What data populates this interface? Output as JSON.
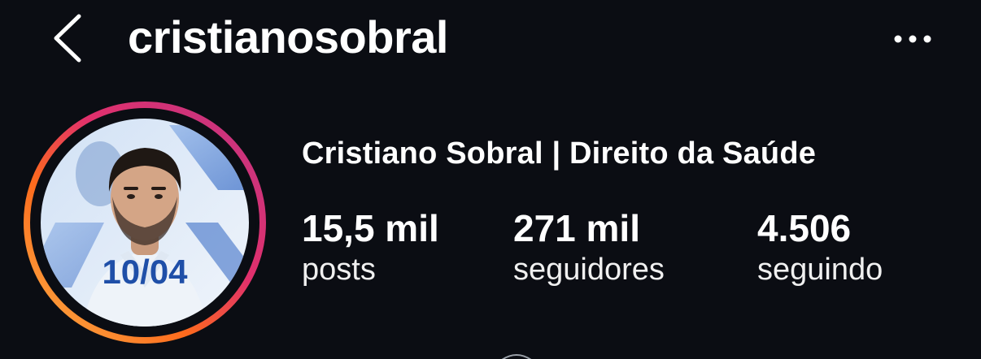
{
  "header": {
    "username": "cristianosobral",
    "back_icon": "chevron-left-icon",
    "more_icon": "more-horizontal-icon"
  },
  "profile": {
    "display_name": "Cristiano Sobral | Direito da Saúde",
    "avatar_overlay_text": "10/04",
    "story_ring_colors": [
      "#fcb045",
      "#fd1d1d",
      "#e1306c",
      "#c13584",
      "#833ab4"
    ]
  },
  "stats": {
    "posts": {
      "value": "15,5 mil",
      "label": "posts"
    },
    "followers": {
      "value": "271 mil",
      "label": "seguidores"
    },
    "following": {
      "value": "4.506",
      "label": "seguindo"
    }
  },
  "colors": {
    "background": "#0b0d13",
    "text": "#ffffff",
    "overlay_date": "#1f4fa8"
  }
}
